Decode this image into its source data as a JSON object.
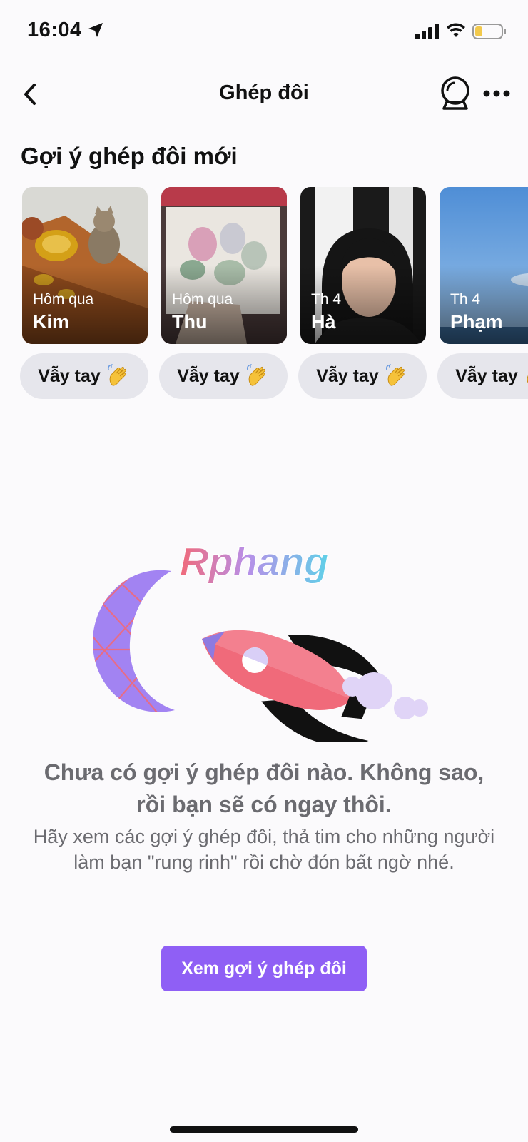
{
  "status_bar": {
    "time": "16:04",
    "icons": [
      "location-arrow-icon",
      "signal-icon",
      "wifi-icon",
      "battery-low-icon"
    ],
    "battery_color": "#f2c94c"
  },
  "header": {
    "title": "Ghép đôi",
    "icons": [
      "back-chevron-icon",
      "crystal-ball-icon",
      "more-icon"
    ]
  },
  "suggestions": {
    "title": "Gợi ý ghép đôi mới",
    "wave_label": "Vẫy tay",
    "wave_icon": "waving-hand-icon",
    "cards": [
      {
        "date": "Hôm qua",
        "name": "Kim"
      },
      {
        "date": "Hôm qua",
        "name": "Thu"
      },
      {
        "date": "Th 4",
        "name": "Hà"
      },
      {
        "date": "Th 4",
        "name": "Phạm"
      }
    ]
  },
  "empty_state": {
    "watermark": "Rphang",
    "title": "Chưa có gợi ý ghép đôi nào. Không sao, rồi bạn sẽ có ngay thôi.",
    "description": "Hãy xem các gợi ý ghép đôi, thả tim cho những người làm bạn \"rung rinh\" rồi chờ đón bất ngờ nhé.",
    "button_label": "Xem gợi ý ghép đôi",
    "accent_color": "#8f5ff5"
  }
}
